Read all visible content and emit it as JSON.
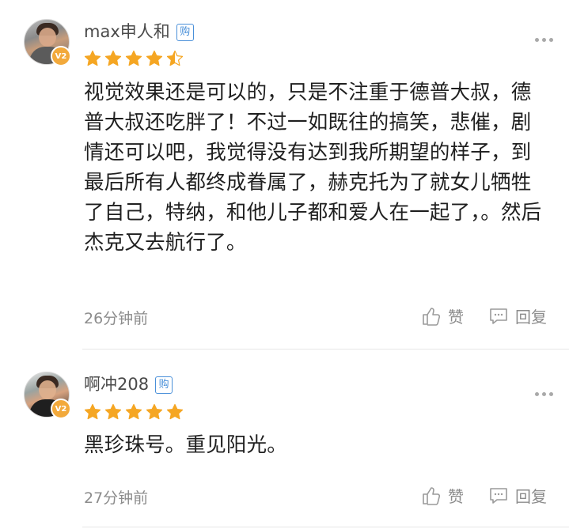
{
  "comments": [
    {
      "user_name": "max申人和",
      "buy_badge": "购",
      "level_badge": "V2",
      "rating": 4.5,
      "text": "视觉效果还是可以的，只是不注重于德普大叔，德普大叔还吃胖了！不过一如既往的搞笑，悲催，剧情还可以吧，我觉得没有达到我所期望的样子，到最后所有人都终成眷属了，赫克托为了就女儿牺牲了自己，特纳，和他儿子都和爱人在一起了，。然后杰克又去航行了。",
      "time": "26分钟前",
      "like_label": "赞",
      "reply_label": "回复"
    },
    {
      "user_name": "啊冲208",
      "buy_badge": "购",
      "level_badge": "V2",
      "rating": 5,
      "text": "黑珍珠号。重见阳光。",
      "time": "27分钟前",
      "like_label": "赞",
      "reply_label": "回复"
    }
  ],
  "icons": {
    "like": "thumbs-up-icon",
    "reply": "comment-bubble-icon",
    "more": "more-dots-icon",
    "star": "star-icon"
  },
  "colors": {
    "star": "#f5a623",
    "badge_blue": "#4a90d9",
    "level_badge": "#f2a93b",
    "muted_text": "#8c8c8c"
  }
}
